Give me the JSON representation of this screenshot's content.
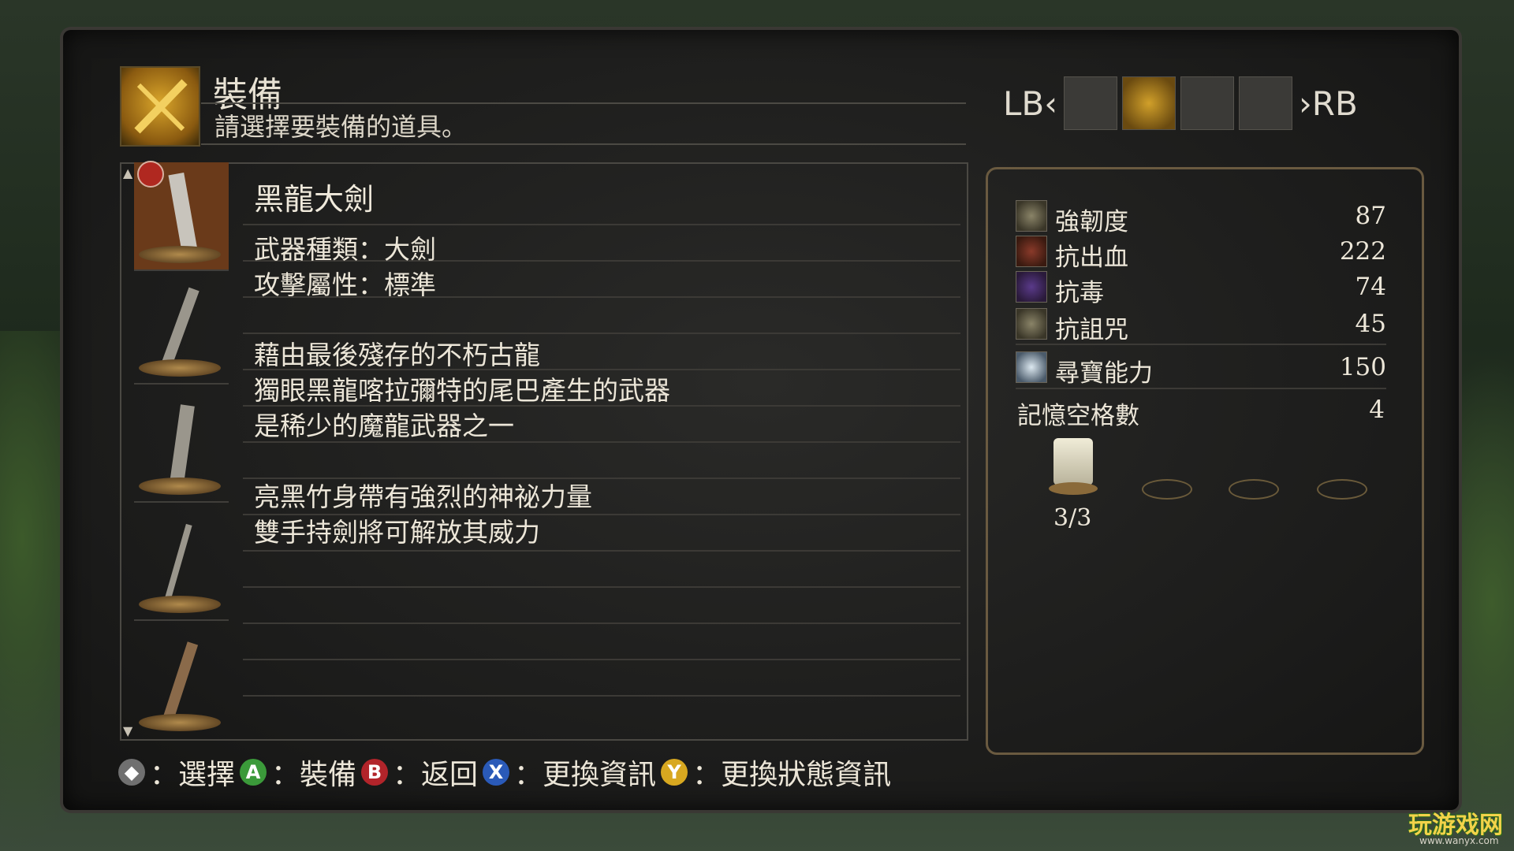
{
  "header": {
    "title": "裝備",
    "subtitle": "請選擇要裝備的道具。",
    "tab_left": "LB‹",
    "tab_right": "›RB",
    "tabs": [
      "item-pouch-icon",
      "equipment-icon",
      "status-icon",
      "book-icon"
    ],
    "active_tab_index": 1
  },
  "item": {
    "name": "黑龍大劍",
    "weapon_type": "武器種類：大劍",
    "attack_attr": "攻擊屬性：標準",
    "description_1": [
      "藉由最後殘存的不朽古龍",
      "獨眼黑龍喀拉彌特的尾巴產生的武器",
      "是稀少的魔龍武器之一"
    ],
    "description_2": [
      "亮黑竹身帶有強烈的神祕力量",
      "雙手持劍將可解放其威力"
    ]
  },
  "thumbnails": [
    "black-dragon-greatsword",
    "sword-item",
    "spiked-weapon",
    "rapier-item",
    "club-and-shield"
  ],
  "stats": [
    {
      "label": "強韌度",
      "value": "87",
      "icon": "poise-icon"
    },
    {
      "label": "抗出血",
      "value": "222",
      "icon": "bleed-resist-icon"
    },
    {
      "label": "抗毒",
      "value": "74",
      "icon": "poison-resist-icon"
    },
    {
      "label": "抗詛咒",
      "value": "45",
      "icon": "curse-resist-icon"
    },
    {
      "label": "尋寶能力",
      "value": "150",
      "icon": "item-discovery-icon"
    }
  ],
  "memory": {
    "label": "記憶空格數",
    "value": "4",
    "attuned": "3/3"
  },
  "footer": {
    "select": "：選擇",
    "equip": "：裝備",
    "back": "：返回",
    "change_info": "：更換資訊",
    "change_status": "：更換狀態資訊",
    "btn_a": "A",
    "btn_b": "B",
    "btn_x": "X",
    "btn_y": "Y"
  },
  "watermark": {
    "text": "玩游戏网",
    "url": "www.wanyx.com"
  },
  "colors": {
    "gold": "#d9a52a",
    "text": "#ece6d8",
    "btn_a": "#3b9a3a",
    "btn_b": "#b2242a",
    "btn_x": "#2a5ab8",
    "btn_y": "#d8a820"
  }
}
